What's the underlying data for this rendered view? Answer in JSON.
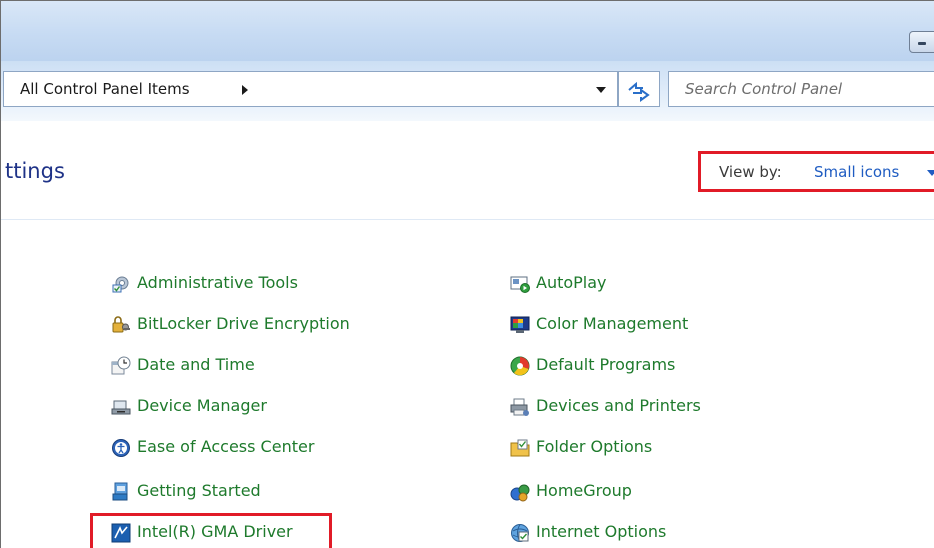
{
  "address": {
    "breadcrumb": "All Control Panel Items"
  },
  "search": {
    "placeholder": "Search Control Panel"
  },
  "page": {
    "heading": "ttings"
  },
  "view_by": {
    "label": "View by:",
    "value": "Small icons"
  },
  "items_left": [
    {
      "label": "Administrative Tools",
      "icon": "administrative-tools-icon"
    },
    {
      "label": "BitLocker Drive Encryption",
      "icon": "bitlocker-icon"
    },
    {
      "label": "Date and Time",
      "icon": "date-time-icon"
    },
    {
      "label": "Device Manager",
      "icon": "device-manager-icon"
    },
    {
      "label": "Ease of Access Center",
      "icon": "ease-of-access-icon"
    },
    {
      "label": "Getting Started",
      "icon": "getting-started-icon"
    },
    {
      "label": "Intel(R) GMA Driver",
      "icon": "intel-gma-icon"
    }
  ],
  "items_right": [
    {
      "label": "AutoPlay",
      "icon": "autoplay-icon"
    },
    {
      "label": "Color Management",
      "icon": "color-management-icon"
    },
    {
      "label": "Default Programs",
      "icon": "default-programs-icon"
    },
    {
      "label": "Devices and Printers",
      "icon": "devices-printers-icon"
    },
    {
      "label": "Folder Options",
      "icon": "folder-options-icon"
    },
    {
      "label": "HomeGroup",
      "icon": "homegroup-icon"
    },
    {
      "label": "Internet Options",
      "icon": "internet-options-icon"
    }
  ],
  "colors": {
    "link_green": "#1e7a2c",
    "heading_blue": "#1e3287",
    "highlight_red": "#e11b27",
    "view_value_blue": "#1f5cc2"
  }
}
